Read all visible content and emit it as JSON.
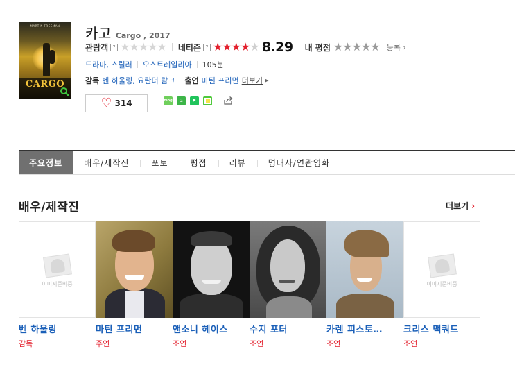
{
  "movie": {
    "title": "카고",
    "original_title_year": "Cargo , 2017",
    "poster_title": "CARGO",
    "audience_label": "관람객",
    "netizen_label": "네티즌",
    "netizen_score": "8.29",
    "netizen_score_value": 8.29,
    "my_rating_label": "내 평점",
    "register_label": "등록",
    "help_mark": "?",
    "genres": [
      "드라마",
      "스릴러"
    ],
    "country": "오스트레일리아",
    "runtime": "105분",
    "director_label": "감독",
    "directors": "벤 하울링, 요란더 람크",
    "cast_label": "출연",
    "cast_names": "마틴 프리먼",
    "more_label": "더보기",
    "likes": "314"
  },
  "share": {
    "icons": [
      "blog-icon",
      "cafe-icon",
      "book-icon",
      "memo-icon",
      "share-icon"
    ],
    "blog_text": "blog"
  },
  "tabs": [
    "주요정보",
    "배우/제작진",
    "포토",
    "평점",
    "리뷰",
    "명대사/연관영화"
  ],
  "section": {
    "title": "배우/제작진",
    "more": "더보기"
  },
  "no_image_text": "이미지준비중",
  "people": [
    {
      "name": "벤 하울링",
      "role": "감독",
      "has_photo": false
    },
    {
      "name": "마틴 프리먼",
      "role": "주연",
      "has_photo": true
    },
    {
      "name": "앤소니 헤이스",
      "role": "조연",
      "has_photo": true
    },
    {
      "name": "수지 포터",
      "role": "조연",
      "has_photo": true
    },
    {
      "name": "카렌 피스토…",
      "role": "조연",
      "has_photo": true
    },
    {
      "name": "크리스 맥쿼드",
      "role": "조연",
      "has_photo": false
    }
  ],
  "colors": {
    "accent_red": "#e3202d",
    "link_blue": "#1a5fb8",
    "active_tab": "#707070"
  }
}
